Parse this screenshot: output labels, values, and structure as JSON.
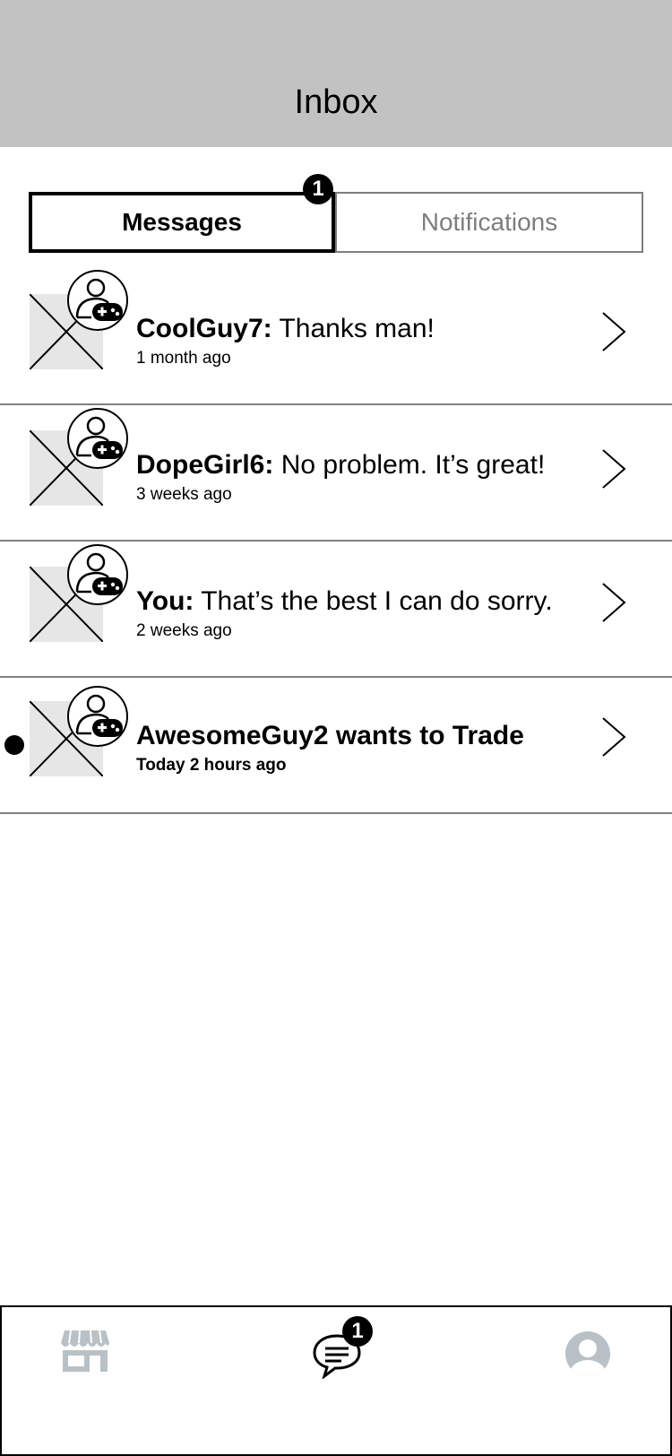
{
  "header": {
    "title": "Inbox"
  },
  "tabs": {
    "messages_label": "Messages",
    "notifications_label": "Notifications",
    "messages_badge": "1"
  },
  "conversations": [
    {
      "sender": "CoolGuy7:",
      "text": " Thanks man!",
      "time": "1 month ago",
      "unread": false
    },
    {
      "sender": "DopeGirl6:",
      "text": " No problem. It’s great!",
      "time": "3 weeks ago",
      "unread": false
    },
    {
      "sender": "You:",
      "text": " That’s the best I can do sorry.",
      "time": "2 weeks ago",
      "unread": false
    },
    {
      "sender": "AwesomeGuy2 wants to Trade",
      "text": "",
      "time": "Today  2 hours ago",
      "unread": true
    }
  ],
  "bottom_nav": {
    "items": [
      {
        "icon": "store-icon"
      },
      {
        "icon": "chat-icon"
      },
      {
        "icon": "profile-icon"
      }
    ],
    "chat_badge": "1"
  },
  "colors": {
    "header_bg": "#c2c2c2",
    "inactive_text": "#7d7d7d",
    "divider": "#808080",
    "icon_gray": "#b9c1c6"
  }
}
